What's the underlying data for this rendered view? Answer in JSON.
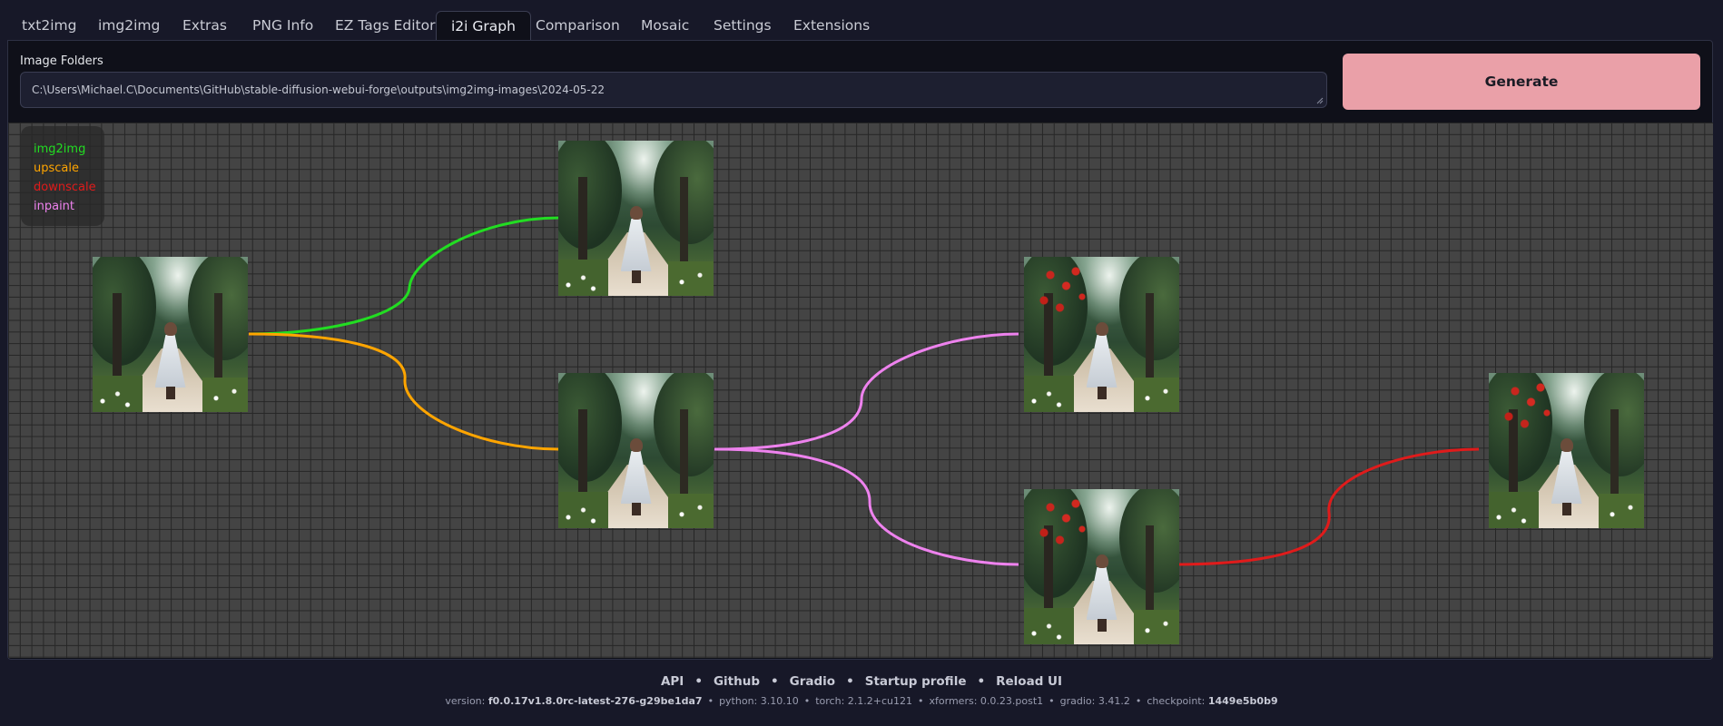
{
  "tabs": [
    {
      "label": "txt2img",
      "active": false
    },
    {
      "label": "img2img",
      "active": false
    },
    {
      "label": "Extras",
      "active": false
    },
    {
      "label": "PNG Info",
      "active": false
    },
    {
      "label": "EZ Tags Editor",
      "active": false
    },
    {
      "label": "i2i Graph",
      "active": true
    },
    {
      "label": "Comparison",
      "active": false
    },
    {
      "label": "Mosaic",
      "active": false
    },
    {
      "label": "Settings",
      "active": false
    },
    {
      "label": "Extensions",
      "active": false
    }
  ],
  "folders": {
    "label": "Image Folders",
    "value": "C:\\Users\\Michael.C\\Documents\\GitHub\\stable-diffusion-webui-forge\\outputs\\img2img-images\\2024-05-22"
  },
  "generate_label": "Generate",
  "legend": [
    {
      "label": "img2img",
      "color": "#22dd22"
    },
    {
      "label": "upscale",
      "color": "#ffa500"
    },
    {
      "label": "downscale",
      "color": "#e01b1b"
    },
    {
      "label": "inpaint",
      "color": "#ee82ee"
    }
  ],
  "graph": {
    "nodes": [
      {
        "id": "source",
        "apples": false
      },
      {
        "id": "img2img-result",
        "apples": false
      },
      {
        "id": "upscaled",
        "apples": false
      },
      {
        "id": "inpaint-a",
        "apples": true
      },
      {
        "id": "inpaint-b",
        "apples": true
      },
      {
        "id": "downscaled",
        "apples": true
      }
    ],
    "edges": [
      {
        "from": "source",
        "to": "img2img-result",
        "type": "img2img"
      },
      {
        "from": "source",
        "to": "upscaled",
        "type": "upscale"
      },
      {
        "from": "upscaled",
        "to": "inpaint-a",
        "type": "inpaint"
      },
      {
        "from": "upscaled",
        "to": "inpaint-b",
        "type": "inpaint"
      },
      {
        "from": "inpaint-b",
        "to": "downscaled",
        "type": "downscale"
      }
    ]
  },
  "footer": {
    "links": [
      "API",
      "Github",
      "Gradio",
      "Startup profile",
      "Reload UI"
    ],
    "version_label": "version:",
    "version_value": "f0.0.17v1.8.0rc-latest-276-g29be1da7",
    "python": "python: 3.10.10",
    "torch": "torch: 2.1.2+cu121",
    "xformers": "xformers: 0.0.23.post1",
    "gradio": "gradio: 3.41.2",
    "checkpoint_label": "checkpoint:",
    "checkpoint_value": "1449e5b0b9"
  }
}
